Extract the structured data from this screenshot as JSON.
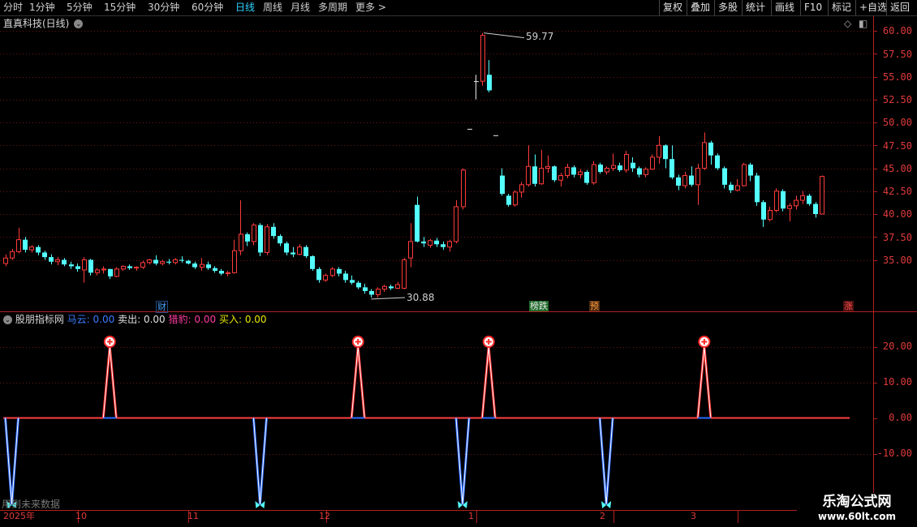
{
  "toolbar": {
    "periods": [
      "分时",
      "1分钟",
      "5分钟",
      "15分钟",
      "30分钟",
      "60分钟",
      "日线",
      "周线",
      "月线",
      "多周期",
      "更多 >"
    ],
    "active_period": "日线",
    "right_buttons": [
      "复权",
      "叠加",
      "多股",
      "统计",
      "画线",
      "F10",
      "标记",
      "+自选",
      "返回"
    ]
  },
  "main_chart": {
    "title": "直真科技(日线)",
    "high_marker": "59.77",
    "low_marker": "30.88",
    "y_ticks": [
      "60.00",
      "57.50",
      "55.00",
      "52.50",
      "50.00",
      "47.50",
      "45.00",
      "42.50",
      "40.00",
      "37.50",
      "35.00"
    ],
    "event_tags": [
      {
        "text": "财",
        "color": "#4aa3ff"
      },
      {
        "text": "榜跌",
        "color": "#e8e8e8"
      },
      {
        "text": "预",
        "color": "#ff9c3a"
      },
      {
        "text": "涨",
        "color": "#ff4040"
      }
    ]
  },
  "indicator": {
    "name": "股朋指标网",
    "fields": [
      {
        "label": "马云:",
        "value": "0.00",
        "color": "#3a7bff"
      },
      {
        "label": "卖出:",
        "value": "0.00",
        "color": "#e0e0e0"
      },
      {
        "label": "猎豹:",
        "value": "0.00",
        "color": "#ff3aa0"
      },
      {
        "label": "买入:",
        "value": "0.00",
        "color": "#e8e800"
      }
    ],
    "y_ticks": [
      "20.00",
      "10.00",
      "0.00",
      "-10.00"
    ],
    "footer_hint": "用到未来数据"
  },
  "dates": [
    "2025年",
    "10",
    "11",
    "12",
    "1",
    "2",
    "3"
  ],
  "watermark": {
    "line1": "乐淘公式网",
    "line2": "www.60lt.com"
  },
  "chart_data": {
    "type": "candlestick",
    "title": "直真科技(日线)",
    "ylim": [
      29.5,
      61
    ],
    "y_ticks": [
      35,
      37.5,
      40,
      42.5,
      45,
      47.5,
      50,
      52.5,
      55,
      57.5,
      60
    ],
    "x_labels": [
      "2025年",
      "10",
      "11",
      "12",
      "1",
      "2",
      "3"
    ],
    "x_label_bar_index": [
      0,
      12,
      29,
      50,
      73,
      94,
      113
    ],
    "annotations": {
      "high": 59.77,
      "low": 30.88
    },
    "ohlc": [
      [
        34.6,
        35.6,
        34.3,
        35.2
      ],
      [
        35.2,
        36.2,
        35.0,
        35.9
      ],
      [
        35.9,
        38.5,
        35.7,
        37.2
      ],
      [
        37.2,
        37.5,
        35.8,
        36.1
      ],
      [
        36.1,
        36.6,
        35.8,
        36.4
      ],
      [
        36.4,
        36.6,
        35.5,
        35.8
      ],
      [
        35.8,
        36.0,
        35.0,
        35.3
      ],
      [
        35.3,
        35.6,
        34.5,
        34.8
      ],
      [
        34.8,
        35.3,
        34.4,
        35.0
      ],
      [
        35.0,
        35.2,
        34.3,
        34.5
      ],
      [
        34.5,
        34.8,
        34.0,
        34.3
      ],
      [
        34.3,
        34.6,
        33.7,
        34.0
      ],
      [
        33.9,
        35.3,
        32.5,
        35.0
      ],
      [
        35.0,
        35.1,
        33.3,
        33.6
      ],
      [
        33.6,
        34.1,
        33.3,
        33.9
      ],
      [
        33.9,
        34.3,
        33.5,
        34.0
      ],
      [
        34.0,
        34.0,
        32.9,
        33.2
      ],
      [
        33.2,
        34.2,
        33.1,
        34.0
      ],
      [
        34.0,
        34.4,
        33.8,
        34.3
      ],
      [
        34.3,
        34.5,
        33.9,
        34.1
      ],
      [
        34.1,
        34.3,
        33.8,
        34.2
      ],
      [
        34.2,
        34.9,
        34.0,
        34.7
      ],
      [
        34.7,
        35.1,
        34.5,
        35.0
      ],
      [
        35.0,
        35.5,
        34.4,
        34.6
      ],
      [
        34.6,
        35.0,
        34.4,
        34.8
      ],
      [
        34.8,
        35.1,
        34.5,
        34.7
      ],
      [
        34.7,
        35.2,
        34.5,
        35.0
      ],
      [
        35.0,
        35.4,
        34.7,
        34.9
      ],
      [
        34.9,
        35.0,
        34.5,
        34.6
      ],
      [
        34.6,
        34.8,
        34.0,
        34.2
      ],
      [
        34.2,
        35.2,
        33.8,
        34.5
      ],
      [
        34.5,
        34.8,
        33.9,
        34.1
      ],
      [
        34.1,
        34.3,
        33.6,
        33.8
      ],
      [
        33.8,
        34.0,
        33.3,
        33.5
      ],
      [
        33.5,
        33.8,
        33.2,
        33.6
      ],
      [
        33.6,
        37.2,
        33.5,
        36.0
      ],
      [
        36.0,
        41.5,
        35.5,
        37.8
      ],
      [
        37.8,
        38.0,
        36.5,
        37.0
      ],
      [
        37.0,
        39.0,
        36.6,
        38.8
      ],
      [
        38.8,
        39.0,
        35.4,
        35.8
      ],
      [
        35.8,
        38.9,
        35.5,
        38.6
      ],
      [
        38.6,
        39.0,
        37.3,
        37.6
      ],
      [
        37.6,
        37.8,
        36.5,
        36.8
      ],
      [
        36.8,
        37.0,
        35.5,
        35.8
      ],
      [
        35.8,
        36.4,
        35.3,
        35.6
      ],
      [
        35.6,
        36.7,
        35.5,
        36.4
      ],
      [
        36.4,
        36.6,
        35.2,
        35.4
      ],
      [
        35.4,
        35.5,
        33.8,
        34.0
      ],
      [
        34.0,
        34.2,
        32.5,
        32.8
      ],
      [
        32.8,
        33.5,
        32.6,
        33.3
      ],
      [
        33.3,
        34.2,
        33.1,
        34.0
      ],
      [
        34.0,
        34.2,
        33.2,
        33.5
      ],
      [
        33.5,
        33.8,
        32.5,
        32.8
      ],
      [
        32.8,
        33.3,
        32.3,
        32.5
      ],
      [
        32.5,
        32.7,
        31.8,
        32.0
      ],
      [
        32.0,
        32.4,
        31.3,
        31.6
      ],
      [
        31.6,
        31.8,
        30.9,
        31.2
      ],
      [
        31.2,
        32.0,
        30.9,
        31.8
      ],
      [
        31.8,
        32.3,
        31.5,
        32.1
      ],
      [
        32.1,
        32.3,
        31.7,
        31.9
      ],
      [
        31.9,
        32.6,
        31.8,
        32.3
      ],
      [
        31.9,
        35.2,
        31.8,
        35.0
      ],
      [
        35.2,
        39.0,
        34.2,
        37.0
      ],
      [
        41.0,
        41.9,
        36.9,
        37.0
      ],
      [
        37.0,
        37.5,
        36.4,
        36.8
      ],
      [
        36.6,
        37.3,
        36.3,
        37.1
      ],
      [
        37.1,
        37.4,
        36.4,
        36.7
      ],
      [
        36.7,
        37.0,
        36.1,
        36.4
      ],
      [
        36.4,
        37.2,
        35.9,
        37.0
      ],
      [
        37.0,
        41.5,
        36.8,
        40.8
      ],
      [
        40.8,
        45.0,
        40.5,
        44.8
      ],
      [
        49.3,
        49.3,
        49.3,
        49.3
      ],
      [
        54.5,
        55.2,
        52.5,
        54.5
      ],
      [
        54.5,
        59.77,
        54.0,
        59.5
      ],
      [
        55.2,
        56.8,
        53.3,
        53.5
      ],
      [
        48.6,
        48.6,
        48.6,
        48.6
      ],
      [
        44.2,
        45.0,
        42.0,
        42.2
      ],
      [
        42.0,
        42.2,
        40.8,
        41.0
      ],
      [
        41.0,
        42.6,
        40.8,
        42.4
      ],
      [
        42.4,
        43.5,
        41.8,
        43.2
      ],
      [
        43.2,
        47.5,
        43.0,
        45.2
      ],
      [
        45.2,
        46.5,
        43.0,
        43.3
      ],
      [
        43.3,
        47.0,
        43.2,
        45.0
      ],
      [
        45.0,
        46.4,
        44.5,
        45.2
      ],
      [
        45.2,
        45.3,
        43.5,
        43.7
      ],
      [
        43.7,
        44.5,
        43.0,
        44.2
      ],
      [
        44.2,
        45.5,
        43.9,
        45.1
      ],
      [
        45.1,
        45.3,
        44.0,
        44.3
      ],
      [
        44.3,
        44.9,
        43.9,
        44.6
      ],
      [
        44.6,
        44.8,
        43.2,
        43.4
      ],
      [
        43.4,
        45.8,
        43.2,
        45.4
      ],
      [
        45.4,
        45.6,
        44.4,
        44.6
      ],
      [
        44.6,
        45.2,
        44.3,
        45.0
      ],
      [
        45.0,
        46.6,
        44.7,
        45.3
      ],
      [
        45.3,
        45.6,
        44.6,
        44.8
      ],
      [
        44.8,
        46.9,
        44.5,
        46.5
      ],
      [
        45.6,
        46.2,
        44.6,
        45.0
      ],
      [
        45.0,
        45.2,
        44.0,
        44.3
      ],
      [
        44.3,
        45.1,
        44.0,
        44.9
      ],
      [
        44.9,
        46.5,
        44.8,
        46.2
      ],
      [
        46.2,
        48.5,
        45.5,
        47.5
      ],
      [
        47.5,
        47.6,
        45.0,
        46.0
      ],
      [
        46.0,
        47.5,
        43.8,
        44.0
      ],
      [
        44.0,
        44.3,
        42.6,
        43.1
      ],
      [
        43.1,
        44.6,
        42.8,
        44.2
      ],
      [
        44.2,
        45.2,
        43.0,
        43.2
      ],
      [
        43.2,
        45.5,
        41.0,
        45.0
      ],
      [
        45.0,
        48.9,
        44.8,
        47.8
      ],
      [
        47.8,
        48.0,
        45.4,
        46.4
      ],
      [
        46.4,
        46.6,
        44.8,
        45.0
      ],
      [
        45.0,
        45.2,
        42.8,
        43.2
      ],
      [
        43.2,
        43.5,
        42.3,
        42.6
      ],
      [
        42.6,
        43.8,
        42.5,
        43.1
      ],
      [
        43.1,
        45.6,
        43.0,
        45.4
      ],
      [
        45.4,
        45.6,
        43.6,
        44.2
      ],
      [
        44.2,
        44.5,
        40.9,
        41.3
      ],
      [
        41.3,
        41.5,
        38.6,
        39.4
      ],
      [
        39.4,
        40.8,
        39.2,
        40.4
      ],
      [
        40.4,
        42.8,
        40.2,
        42.5
      ],
      [
        42.5,
        42.7,
        40.3,
        40.6
      ],
      [
        40.6,
        41.2,
        39.2,
        40.9
      ],
      [
        40.9,
        42.0,
        40.5,
        41.5
      ],
      [
        41.5,
        42.5,
        41.1,
        42.0
      ],
      [
        42.0,
        42.2,
        40.9,
        41.1
      ],
      [
        41.1,
        41.3,
        39.6,
        40.0
      ],
      [
        40.0,
        44.2,
        40.0,
        44.1
      ]
    ],
    "indicator_signals": {
      "sell_peak_bar_index": [
        16,
        54,
        74,
        107
      ],
      "buy_trough_bar_index": [
        1,
        39,
        70,
        92
      ],
      "ylim": [
        -10,
        20
      ]
    }
  }
}
